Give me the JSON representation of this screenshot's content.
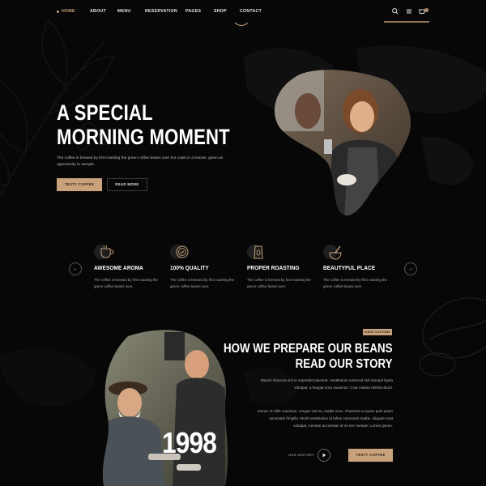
{
  "nav": {
    "items": [
      {
        "label": "HOME",
        "active": true
      },
      {
        "label": "ABOUT",
        "active": false
      },
      {
        "label": "MENU",
        "active": false
      },
      {
        "label": "RESERVATION",
        "active": false
      },
      {
        "label": "PAGES",
        "active": false
      },
      {
        "label": "SHOP",
        "active": false
      },
      {
        "label": "CONTACT",
        "active": false
      }
    ],
    "icons": [
      "search-icon",
      "menu-icon",
      "cart-icon"
    ],
    "cart_count": "0"
  },
  "hero": {
    "title_line1": "A SPECIAL",
    "title_line2": "MORNING MOMENT",
    "description": "The coffee is brewed by first roasting the green coffee beans over hot coals in a brazier, given an opportunity to sample.",
    "primary_button": "TESTY COFFEE",
    "secondary_button": "READ MORE"
  },
  "features": [
    {
      "icon": "coffee-cup-icon",
      "title": "AWESOME AROMA",
      "text": "The coffee is brewed by first roasting the green coffee beans over."
    },
    {
      "icon": "quality-badge-icon",
      "title": "100% QUALITY",
      "text": "The coffee is brewed by first roasting the green coffee beans over."
    },
    {
      "icon": "coffee-bag-icon",
      "title": "PROPER ROASTING",
      "text": "The coffee is brewed by first roasting the green coffee beans over."
    },
    {
      "icon": "mortar-pestle-icon",
      "title": "BEAUTYFUL PLACE",
      "text": "The coffee is brewed by first roasting the green coffee beans over."
    }
  ],
  "carousel": {
    "prev": "←",
    "next": "→"
  },
  "story": {
    "tag": "SINCE CUSTOMS",
    "title_line1": "HOW WE PREPARE OUR BEANS",
    "title_line2": "READ OUR STORY",
    "paragraph1": "Mauris rhoncus orci in imperdiet placerat. Vestibulum euismod nisl suscipit ligula volutpat, a feugiat urna maximus. Cras massa nibhtincidunt.",
    "paragraph2": "Donec et nibh maximus, congue est eu, mattis nunc. Praesent ut quam quis quam venenatis fringilla. Morbi vestibulum id tellus commodo mattis. Aliquam erat volutpat. Aenean accumsan id mi nec semper. Lorem ipsum.",
    "year": "1998",
    "history_label": "OUR HISTORY",
    "button": "TESTY COFFEE"
  },
  "colors": {
    "accent": "#c9a27c",
    "background": "#070707",
    "text": "#ffffff"
  }
}
